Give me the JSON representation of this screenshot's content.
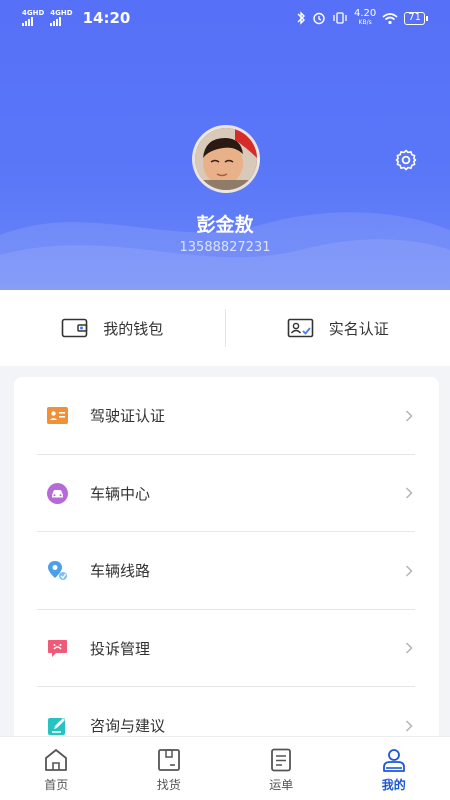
{
  "status_bar": {
    "signal1": "4GHD",
    "signal2": "4GHD",
    "time": "14:20",
    "speed_value": "4.20",
    "speed_unit": "KB/s",
    "battery": "71"
  },
  "profile": {
    "name": "彭金敖",
    "phone": "13588827231"
  },
  "quick_actions": [
    {
      "label": "我的钱包",
      "icon": "wallet-icon"
    },
    {
      "label": "实名认证",
      "icon": "id-card-icon"
    }
  ],
  "menu": [
    {
      "label": "驾驶证认证",
      "icon": "driver-license-icon",
      "color": "#f0913a"
    },
    {
      "label": "车辆中心",
      "icon": "car-icon",
      "color": "#b66ad8"
    },
    {
      "label": "车辆线路",
      "icon": "route-icon",
      "color": "#4da0e8"
    },
    {
      "label": "投诉管理",
      "icon": "complaint-icon",
      "color": "#ee5a78"
    },
    {
      "label": "咨询与建议",
      "icon": "feedback-icon",
      "color": "#27c3c0"
    }
  ],
  "tabs": [
    {
      "label": "首页",
      "icon": "home-icon",
      "active": false
    },
    {
      "label": "找货",
      "icon": "cargo-icon",
      "active": false
    },
    {
      "label": "运单",
      "icon": "waybill-icon",
      "active": false
    },
    {
      "label": "我的",
      "icon": "user-icon",
      "active": true
    }
  ],
  "colors": {
    "header": "#5670f7",
    "active_tab": "#1c57d6"
  }
}
